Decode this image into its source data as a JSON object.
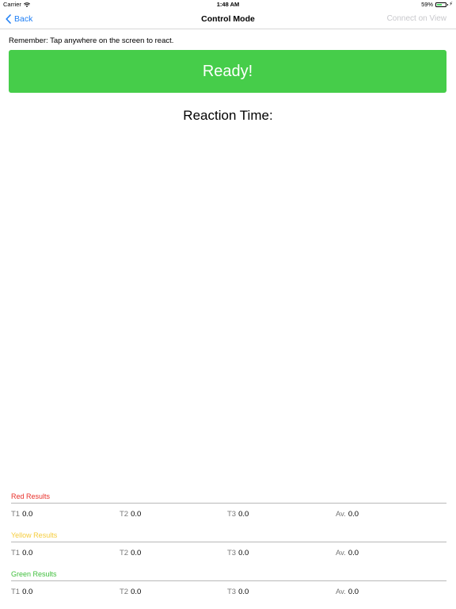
{
  "status_bar": {
    "carrier": "Carrier",
    "time": "1:48 AM",
    "battery_percent": "59%",
    "battery_level": 0.59,
    "battery_color": "#4cd964"
  },
  "nav": {
    "back_label": "Back",
    "title": "Control Mode",
    "right_label": "Connect on View",
    "accent_color": "#1f7ff5"
  },
  "reminder": "Remember: Tap anywhere on the screen to react.",
  "ready_button": {
    "label": "Ready!",
    "color": "#46cd4a"
  },
  "reaction_title": "Reaction Time:",
  "results": [
    {
      "label": "Red Results",
      "color": "#e8302a",
      "cells": [
        {
          "key": "T1",
          "value": "0.0"
        },
        {
          "key": "T2",
          "value": "0.0"
        },
        {
          "key": "T3",
          "value": "0.0"
        },
        {
          "key": "Av.",
          "value": "0.0"
        }
      ]
    },
    {
      "label": "Yellow Results",
      "color": "#f5cc3c",
      "cells": [
        {
          "key": "T1",
          "value": "0.0"
        },
        {
          "key": "T2",
          "value": "0.0"
        },
        {
          "key": "T3",
          "value": "0.0"
        },
        {
          "key": "Av.",
          "value": "0.0"
        }
      ]
    },
    {
      "label": "Green Results",
      "color": "#3fbf3c",
      "cells": [
        {
          "key": "T1",
          "value": "0.0"
        },
        {
          "key": "T2",
          "value": "0.0"
        },
        {
          "key": "T3",
          "value": "0.0"
        },
        {
          "key": "Av.",
          "value": "0.0"
        }
      ]
    }
  ]
}
